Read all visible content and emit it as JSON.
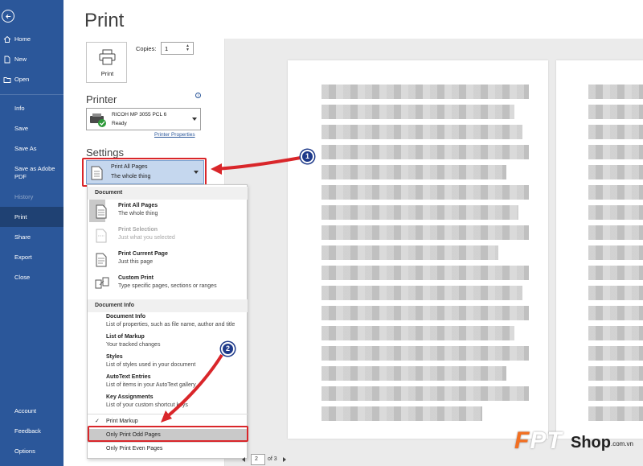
{
  "sidebar": {
    "items": [
      {
        "label": "Home",
        "icon": "home-icon"
      },
      {
        "label": "New",
        "icon": "new-document-icon"
      },
      {
        "label": "Open",
        "icon": "folder-icon"
      },
      {
        "label": "Info"
      },
      {
        "label": "Save"
      },
      {
        "label": "Save As"
      },
      {
        "label": "Save as Adobe PDF"
      },
      {
        "label": "History"
      },
      {
        "label": "Print"
      },
      {
        "label": "Share"
      },
      {
        "label": "Export"
      },
      {
        "label": "Close"
      },
      {
        "label": "Account"
      },
      {
        "label": "Feedback"
      },
      {
        "label": "Options"
      }
    ]
  },
  "page_title": "Print",
  "print_button_label": "Print",
  "copies": {
    "label": "Copies:",
    "value": "1"
  },
  "printer": {
    "heading": "Printer",
    "name": "RICOH MP 3055 PCL 6",
    "status": "Ready",
    "properties_link": "Printer Properties"
  },
  "settings": {
    "heading": "Settings",
    "pages_dropdown": {
      "title": "Print All Pages",
      "subtitle": "The whole thing"
    }
  },
  "menu": {
    "document_header": "Document",
    "document_items": [
      {
        "name": "Print All Pages",
        "desc": "The whole thing"
      },
      {
        "name": "Print Selection",
        "desc": "Just what you selected"
      },
      {
        "name": "Print Current Page",
        "desc": "Just this page"
      },
      {
        "name": "Custom Print",
        "desc": "Type specific pages, sections or ranges"
      }
    ],
    "info_header": "Document Info",
    "info_items": [
      {
        "name": "Document Info",
        "desc": "List of properties, such as file name, author and title"
      },
      {
        "name": "List of Markup",
        "desc": "Your tracked changes"
      },
      {
        "name": "Styles",
        "desc": "List of styles used in your document"
      },
      {
        "name": "AutoText Entries",
        "desc": "List of items in your AutoText gallery"
      },
      {
        "name": "Key Assignments",
        "desc": "List of your custom shortcut keys"
      }
    ],
    "options": [
      {
        "label": "Print Markup",
        "check": "✓"
      },
      {
        "label": "Only Print Odd Pages"
      },
      {
        "label": "Only Print Even Pages"
      }
    ]
  },
  "pager": {
    "current_page": "2",
    "of_text": "of 3"
  },
  "callouts": {
    "one": "1",
    "two": "2"
  },
  "watermark": {
    "brand_f": "F",
    "brand_pt": "PT",
    "shop": "Shop",
    "domain": ".com.vn"
  },
  "colors": {
    "sidebar": "#2b579a",
    "highlight": "#d9262a",
    "badge": "#1e3a8a",
    "brand_orange": "#f26f21"
  }
}
